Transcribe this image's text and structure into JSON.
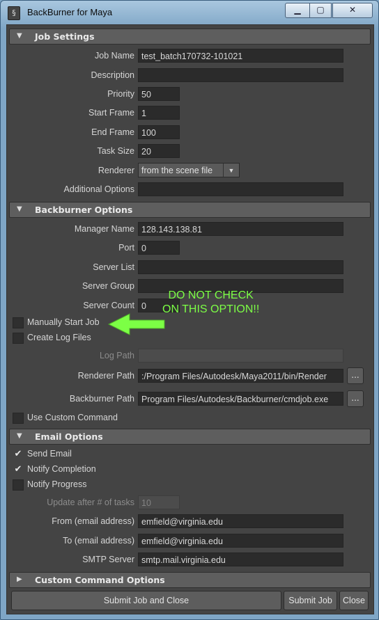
{
  "window": {
    "title": "BackBurner for Maya",
    "icon": "backburner-app-icon"
  },
  "title_buttons": {
    "minimize": "▁",
    "maximize": "▢",
    "close": "✕"
  },
  "job_settings": {
    "header": "Job Settings",
    "job_name": {
      "label": "Job Name",
      "value": "test_batch170732-101021"
    },
    "description": {
      "label": "Description",
      "value": ""
    },
    "priority": {
      "label": "Priority",
      "value": "50"
    },
    "start_frame": {
      "label": "Start Frame",
      "value": "1"
    },
    "end_frame": {
      "label": "End Frame",
      "value": "100"
    },
    "task_size": {
      "label": "Task Size",
      "value": "20"
    },
    "renderer": {
      "label": "Renderer",
      "value": "from the scene file"
    },
    "additional_options": {
      "label": "Additional Options",
      "value": ""
    }
  },
  "backburner_options": {
    "header": "Backburner Options",
    "manager_name": {
      "label": "Manager Name",
      "value": "128.143.138.81"
    },
    "port": {
      "label": "Port",
      "value": "0"
    },
    "server_list": {
      "label": "Server List",
      "value": ""
    },
    "server_group": {
      "label": "Server Group",
      "value": ""
    },
    "server_count": {
      "label": "Server Count",
      "value": "0"
    },
    "manually_start_job": {
      "label": "Manually Start Job",
      "checked": false
    },
    "create_log_files": {
      "label": "Create Log Files",
      "checked": false
    },
    "log_path": {
      "label": "Log Path",
      "value": ""
    },
    "renderer_path": {
      "label": "Renderer Path",
      "value": ":/Program Files/Autodesk/Maya2011/bin/Render"
    },
    "backburner_path": {
      "label": "Backburner Path",
      "value": "Program Files/Autodesk/Backburner/cmdjob.exe"
    },
    "browse_label": "...",
    "use_custom_command": {
      "label": "Use Custom Command",
      "checked": false
    }
  },
  "email_options": {
    "header": "Email Options",
    "send_email": {
      "label": "Send Email",
      "checked": true
    },
    "notify_completion": {
      "label": "Notify Completion",
      "checked": true
    },
    "notify_progress": {
      "label": "Notify Progress",
      "checked": false
    },
    "update_after": {
      "label": "Update after # of tasks",
      "value": "10"
    },
    "from": {
      "label": "From (email address)",
      "value": "emfield@virginia.edu"
    },
    "to": {
      "label": "To (email address)",
      "value": "emfield@virginia.edu"
    },
    "smtp": {
      "label": "SMTP Server",
      "value": "smtp.mail.virginia.edu"
    }
  },
  "custom_command_options": {
    "header": "Custom Command Options"
  },
  "buttons": {
    "submit_close": "Submit Job and Close",
    "submit": "Submit Job",
    "close": "Close"
  },
  "annotation": {
    "line1": "DO NOT CHECK",
    "line2": "ON THIS  OPTION!!",
    "color": "#7cff45"
  },
  "icons": {
    "expanded": "triangle-down-icon",
    "collapsed": "triangle-right-icon",
    "check": "checkmark-icon"
  }
}
